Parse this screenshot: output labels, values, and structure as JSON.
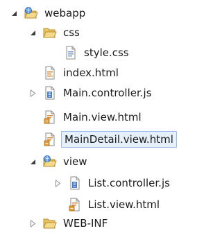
{
  "tree": {
    "root": {
      "label": "webapp",
      "icon": "web-folder-icon",
      "state": "expanded"
    },
    "css": {
      "label": "css",
      "icon": "folder-icon",
      "state": "expanded"
    },
    "style_css": {
      "label": "style.css",
      "icon": "css-file-icon"
    },
    "index_html": {
      "label": "index.html",
      "icon": "html-file-icon"
    },
    "main_controller": {
      "label": "Main.controller.js",
      "icon": "js-file-icon",
      "state": "collapsed"
    },
    "main_view": {
      "label": "Main.view.html",
      "icon": "view-html-file-icon"
    },
    "main_detail_view": {
      "label": "MainDetail.view.html",
      "icon": "view-html-file-icon",
      "selected": true
    },
    "view": {
      "label": "view",
      "icon": "web-folder-icon",
      "state": "expanded"
    },
    "list_controller": {
      "label": "List.controller.js",
      "icon": "js-file-icon",
      "state": "collapsed"
    },
    "list_view": {
      "label": "List.view.html",
      "icon": "view-html-file-icon"
    },
    "web_inf": {
      "label": "WEB-INF",
      "icon": "folder-icon",
      "state": "collapsed"
    }
  },
  "colors": {
    "selection_bg": "#e6f0fb",
    "selection_border": "#99bde6",
    "folder": "#e8c263",
    "globe": "#3b7bd8"
  }
}
